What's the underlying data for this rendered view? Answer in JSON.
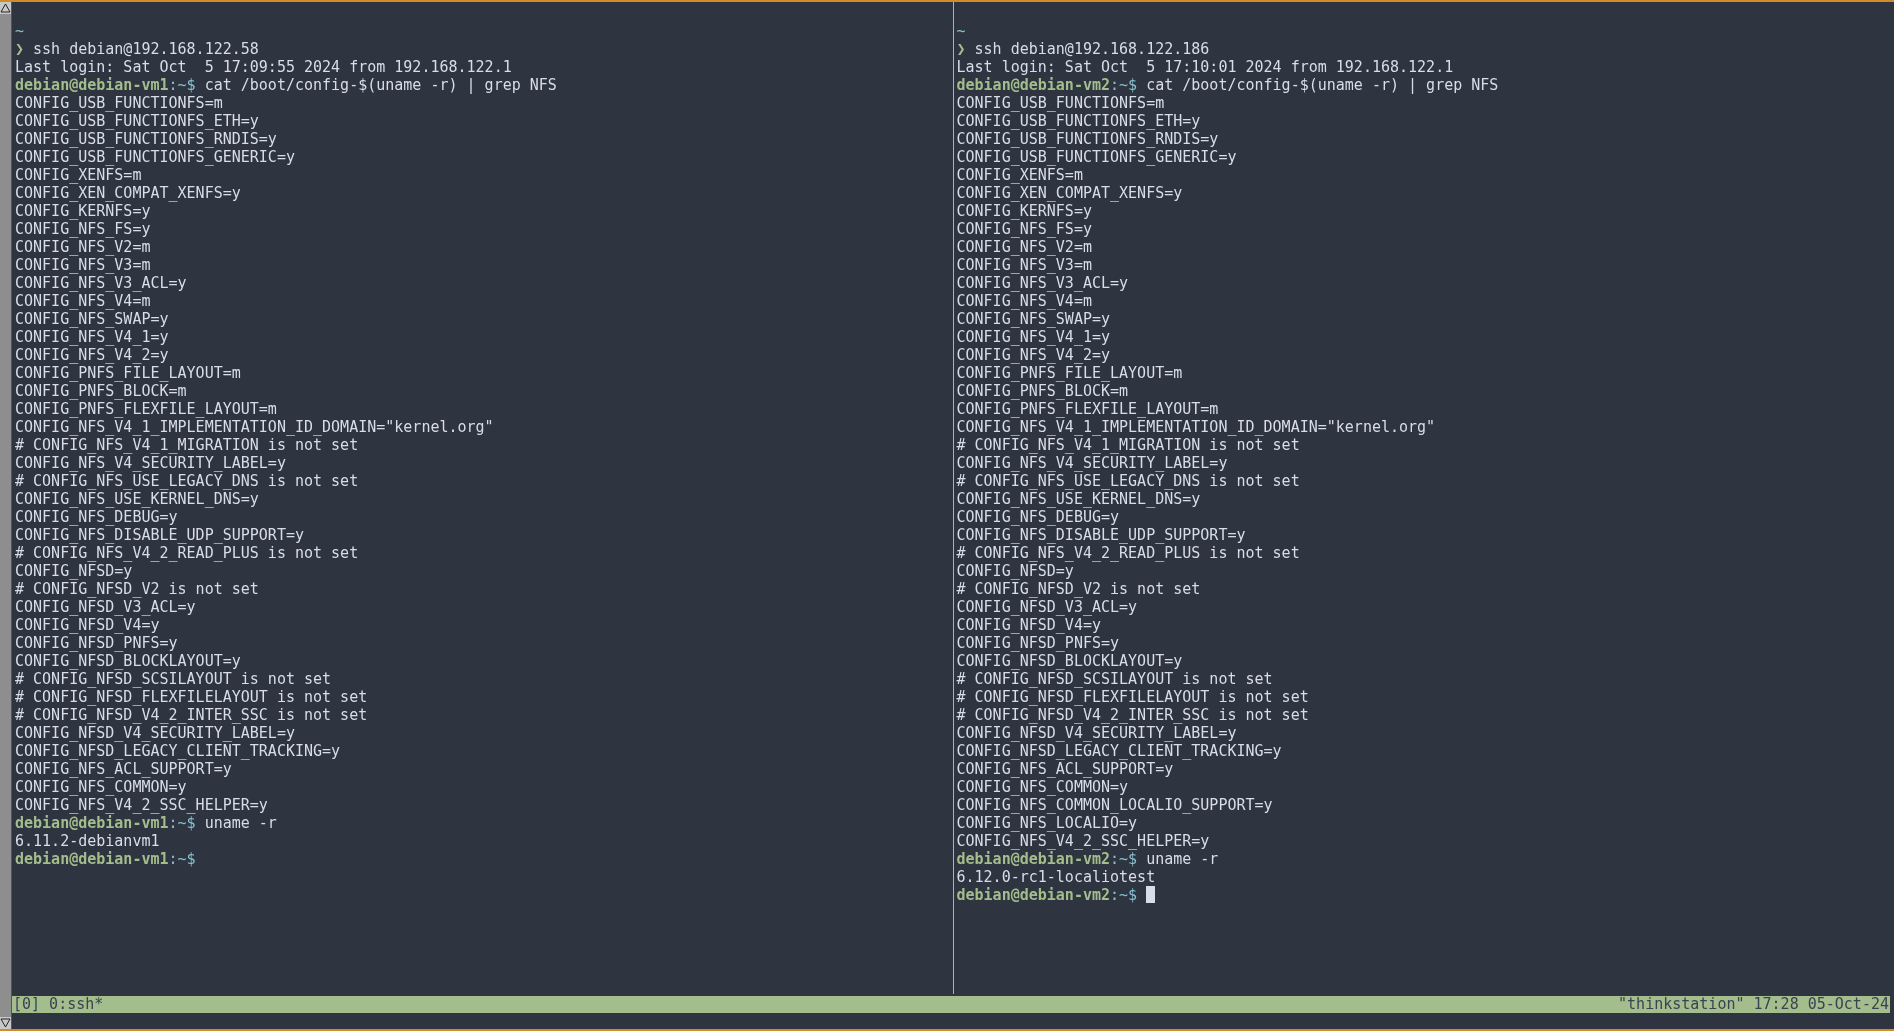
{
  "panes": [
    {
      "lines": [
        {
          "kind": "dir",
          "text": "~"
        },
        {
          "kind": "local",
          "symbol": "❯",
          "text": "ssh debian@192.168.122.58"
        },
        {
          "kind": "output",
          "text": "Last login: Sat Oct  5 17:09:55 2024 from 192.168.122.1"
        },
        {
          "kind": "prompt",
          "user_host": "debian@debian-vm1",
          "path": ":~$",
          "command": "cat /boot/config-$(uname -r) | grep NFS"
        },
        {
          "kind": "output",
          "text": "CONFIG_USB_FUNCTIONFS=m"
        },
        {
          "kind": "output",
          "text": "CONFIG_USB_FUNCTIONFS_ETH=y"
        },
        {
          "kind": "output",
          "text": "CONFIG_USB_FUNCTIONFS_RNDIS=y"
        },
        {
          "kind": "output",
          "text": "CONFIG_USB_FUNCTIONFS_GENERIC=y"
        },
        {
          "kind": "output",
          "text": "CONFIG_XENFS=m"
        },
        {
          "kind": "output",
          "text": "CONFIG_XEN_COMPAT_XENFS=y"
        },
        {
          "kind": "output",
          "text": "CONFIG_KERNFS=y"
        },
        {
          "kind": "output",
          "text": "CONFIG_NFS_FS=y"
        },
        {
          "kind": "output",
          "text": "CONFIG_NFS_V2=m"
        },
        {
          "kind": "output",
          "text": "CONFIG_NFS_V3=m"
        },
        {
          "kind": "output",
          "text": "CONFIG_NFS_V3_ACL=y"
        },
        {
          "kind": "output",
          "text": "CONFIG_NFS_V4=m"
        },
        {
          "kind": "output",
          "text": "CONFIG_NFS_SWAP=y"
        },
        {
          "kind": "output",
          "text": "CONFIG_NFS_V4_1=y"
        },
        {
          "kind": "output",
          "text": "CONFIG_NFS_V4_2=y"
        },
        {
          "kind": "output",
          "text": "CONFIG_PNFS_FILE_LAYOUT=m"
        },
        {
          "kind": "output",
          "text": "CONFIG_PNFS_BLOCK=m"
        },
        {
          "kind": "output",
          "text": "CONFIG_PNFS_FLEXFILE_LAYOUT=m"
        },
        {
          "kind": "output",
          "text": "CONFIG_NFS_V4_1_IMPLEMENTATION_ID_DOMAIN=\"kernel.org\""
        },
        {
          "kind": "output",
          "text": "# CONFIG_NFS_V4_1_MIGRATION is not set"
        },
        {
          "kind": "output",
          "text": "CONFIG_NFS_V4_SECURITY_LABEL=y"
        },
        {
          "kind": "output",
          "text": "# CONFIG_NFS_USE_LEGACY_DNS is not set"
        },
        {
          "kind": "output",
          "text": "CONFIG_NFS_USE_KERNEL_DNS=y"
        },
        {
          "kind": "output",
          "text": "CONFIG_NFS_DEBUG=y"
        },
        {
          "kind": "output",
          "text": "CONFIG_NFS_DISABLE_UDP_SUPPORT=y"
        },
        {
          "kind": "output",
          "text": "# CONFIG_NFS_V4_2_READ_PLUS is not set"
        },
        {
          "kind": "output",
          "text": "CONFIG_NFSD=y"
        },
        {
          "kind": "output",
          "text": "# CONFIG_NFSD_V2 is not set"
        },
        {
          "kind": "output",
          "text": "CONFIG_NFSD_V3_ACL=y"
        },
        {
          "kind": "output",
          "text": "CONFIG_NFSD_V4=y"
        },
        {
          "kind": "output",
          "text": "CONFIG_NFSD_PNFS=y"
        },
        {
          "kind": "output",
          "text": "CONFIG_NFSD_BLOCKLAYOUT=y"
        },
        {
          "kind": "output",
          "text": "# CONFIG_NFSD_SCSILAYOUT is not set"
        },
        {
          "kind": "output",
          "text": "# CONFIG_NFSD_FLEXFILELAYOUT is not set"
        },
        {
          "kind": "output",
          "text": "# CONFIG_NFSD_V4_2_INTER_SSC is not set"
        },
        {
          "kind": "output",
          "text": "CONFIG_NFSD_V4_SECURITY_LABEL=y"
        },
        {
          "kind": "output",
          "text": "CONFIG_NFSD_LEGACY_CLIENT_TRACKING=y"
        },
        {
          "kind": "output",
          "text": "CONFIG_NFS_ACL_SUPPORT=y"
        },
        {
          "kind": "output",
          "text": "CONFIG_NFS_COMMON=y"
        },
        {
          "kind": "output",
          "text": "CONFIG_NFS_V4_2_SSC_HELPER=y"
        },
        {
          "kind": "prompt",
          "user_host": "debian@debian-vm1",
          "path": ":~$",
          "command": "uname -r"
        },
        {
          "kind": "output",
          "text": "6.11.2-debianvm1"
        },
        {
          "kind": "prompt",
          "user_host": "debian@debian-vm1",
          "path": ":~$",
          "cursor": false
        }
      ]
    },
    {
      "lines": [
        {
          "kind": "dir",
          "text": "~"
        },
        {
          "kind": "local",
          "symbol": "❯",
          "text": "ssh debian@192.168.122.186"
        },
        {
          "kind": "output",
          "text": "Last login: Sat Oct  5 17:10:01 2024 from 192.168.122.1"
        },
        {
          "kind": "prompt",
          "user_host": "debian@debian-vm2",
          "path": ":~$",
          "command": "cat /boot/config-$(uname -r) | grep NFS"
        },
        {
          "kind": "output",
          "text": "CONFIG_USB_FUNCTIONFS=m"
        },
        {
          "kind": "output",
          "text": "CONFIG_USB_FUNCTIONFS_ETH=y"
        },
        {
          "kind": "output",
          "text": "CONFIG_USB_FUNCTIONFS_RNDIS=y"
        },
        {
          "kind": "output",
          "text": "CONFIG_USB_FUNCTIONFS_GENERIC=y"
        },
        {
          "kind": "output",
          "text": "CONFIG_XENFS=m"
        },
        {
          "kind": "output",
          "text": "CONFIG_XEN_COMPAT_XENFS=y"
        },
        {
          "kind": "output",
          "text": "CONFIG_KERNFS=y"
        },
        {
          "kind": "output",
          "text": "CONFIG_NFS_FS=y"
        },
        {
          "kind": "output",
          "text": "CONFIG_NFS_V2=m"
        },
        {
          "kind": "output",
          "text": "CONFIG_NFS_V3=m"
        },
        {
          "kind": "output",
          "text": "CONFIG_NFS_V3_ACL=y"
        },
        {
          "kind": "output",
          "text": "CONFIG_NFS_V4=m"
        },
        {
          "kind": "output",
          "text": "CONFIG_NFS_SWAP=y"
        },
        {
          "kind": "output",
          "text": "CONFIG_NFS_V4_1=y"
        },
        {
          "kind": "output",
          "text": "CONFIG_NFS_V4_2=y"
        },
        {
          "kind": "output",
          "text": "CONFIG_PNFS_FILE_LAYOUT=m"
        },
        {
          "kind": "output",
          "text": "CONFIG_PNFS_BLOCK=m"
        },
        {
          "kind": "output",
          "text": "CONFIG_PNFS_FLEXFILE_LAYOUT=m"
        },
        {
          "kind": "output",
          "text": "CONFIG_NFS_V4_1_IMPLEMENTATION_ID_DOMAIN=\"kernel.org\""
        },
        {
          "kind": "output",
          "text": "# CONFIG_NFS_V4_1_MIGRATION is not set"
        },
        {
          "kind": "output",
          "text": "CONFIG_NFS_V4_SECURITY_LABEL=y"
        },
        {
          "kind": "output",
          "text": "# CONFIG_NFS_USE_LEGACY_DNS is not set"
        },
        {
          "kind": "output",
          "text": "CONFIG_NFS_USE_KERNEL_DNS=y"
        },
        {
          "kind": "output",
          "text": "CONFIG_NFS_DEBUG=y"
        },
        {
          "kind": "output",
          "text": "CONFIG_NFS_DISABLE_UDP_SUPPORT=y"
        },
        {
          "kind": "output",
          "text": "# CONFIG_NFS_V4_2_READ_PLUS is not set"
        },
        {
          "kind": "output",
          "text": "CONFIG_NFSD=y"
        },
        {
          "kind": "output",
          "text": "# CONFIG_NFSD_V2 is not set"
        },
        {
          "kind": "output",
          "text": "CONFIG_NFSD_V3_ACL=y"
        },
        {
          "kind": "output",
          "text": "CONFIG_NFSD_V4=y"
        },
        {
          "kind": "output",
          "text": "CONFIG_NFSD_PNFS=y"
        },
        {
          "kind": "output",
          "text": "CONFIG_NFSD_BLOCKLAYOUT=y"
        },
        {
          "kind": "output",
          "text": "# CONFIG_NFSD_SCSILAYOUT is not set"
        },
        {
          "kind": "output",
          "text": "# CONFIG_NFSD_FLEXFILELAYOUT is not set"
        },
        {
          "kind": "output",
          "text": "# CONFIG_NFSD_V4_2_INTER_SSC is not set"
        },
        {
          "kind": "output",
          "text": "CONFIG_NFSD_V4_SECURITY_LABEL=y"
        },
        {
          "kind": "output",
          "text": "CONFIG_NFSD_LEGACY_CLIENT_TRACKING=y"
        },
        {
          "kind": "output",
          "text": "CONFIG_NFS_ACL_SUPPORT=y"
        },
        {
          "kind": "output",
          "text": "CONFIG_NFS_COMMON=y"
        },
        {
          "kind": "output",
          "text": "CONFIG_NFS_COMMON_LOCALIO_SUPPORT=y"
        },
        {
          "kind": "output",
          "text": "CONFIG_NFS_LOCALIO=y"
        },
        {
          "kind": "output",
          "text": "CONFIG_NFS_V4_2_SSC_HELPER=y"
        },
        {
          "kind": "prompt",
          "user_host": "debian@debian-vm2",
          "path": ":~$",
          "command": "uname -r"
        },
        {
          "kind": "output",
          "text": "6.12.0-rc1-localiotest"
        },
        {
          "kind": "prompt",
          "user_host": "debian@debian-vm2",
          "path": ":~$",
          "cursor": true
        }
      ]
    }
  ],
  "status_bar": {
    "left": "[0] 0:ssh*",
    "right": "\"thinkstation\" 17:28 05-Oct-24"
  }
}
